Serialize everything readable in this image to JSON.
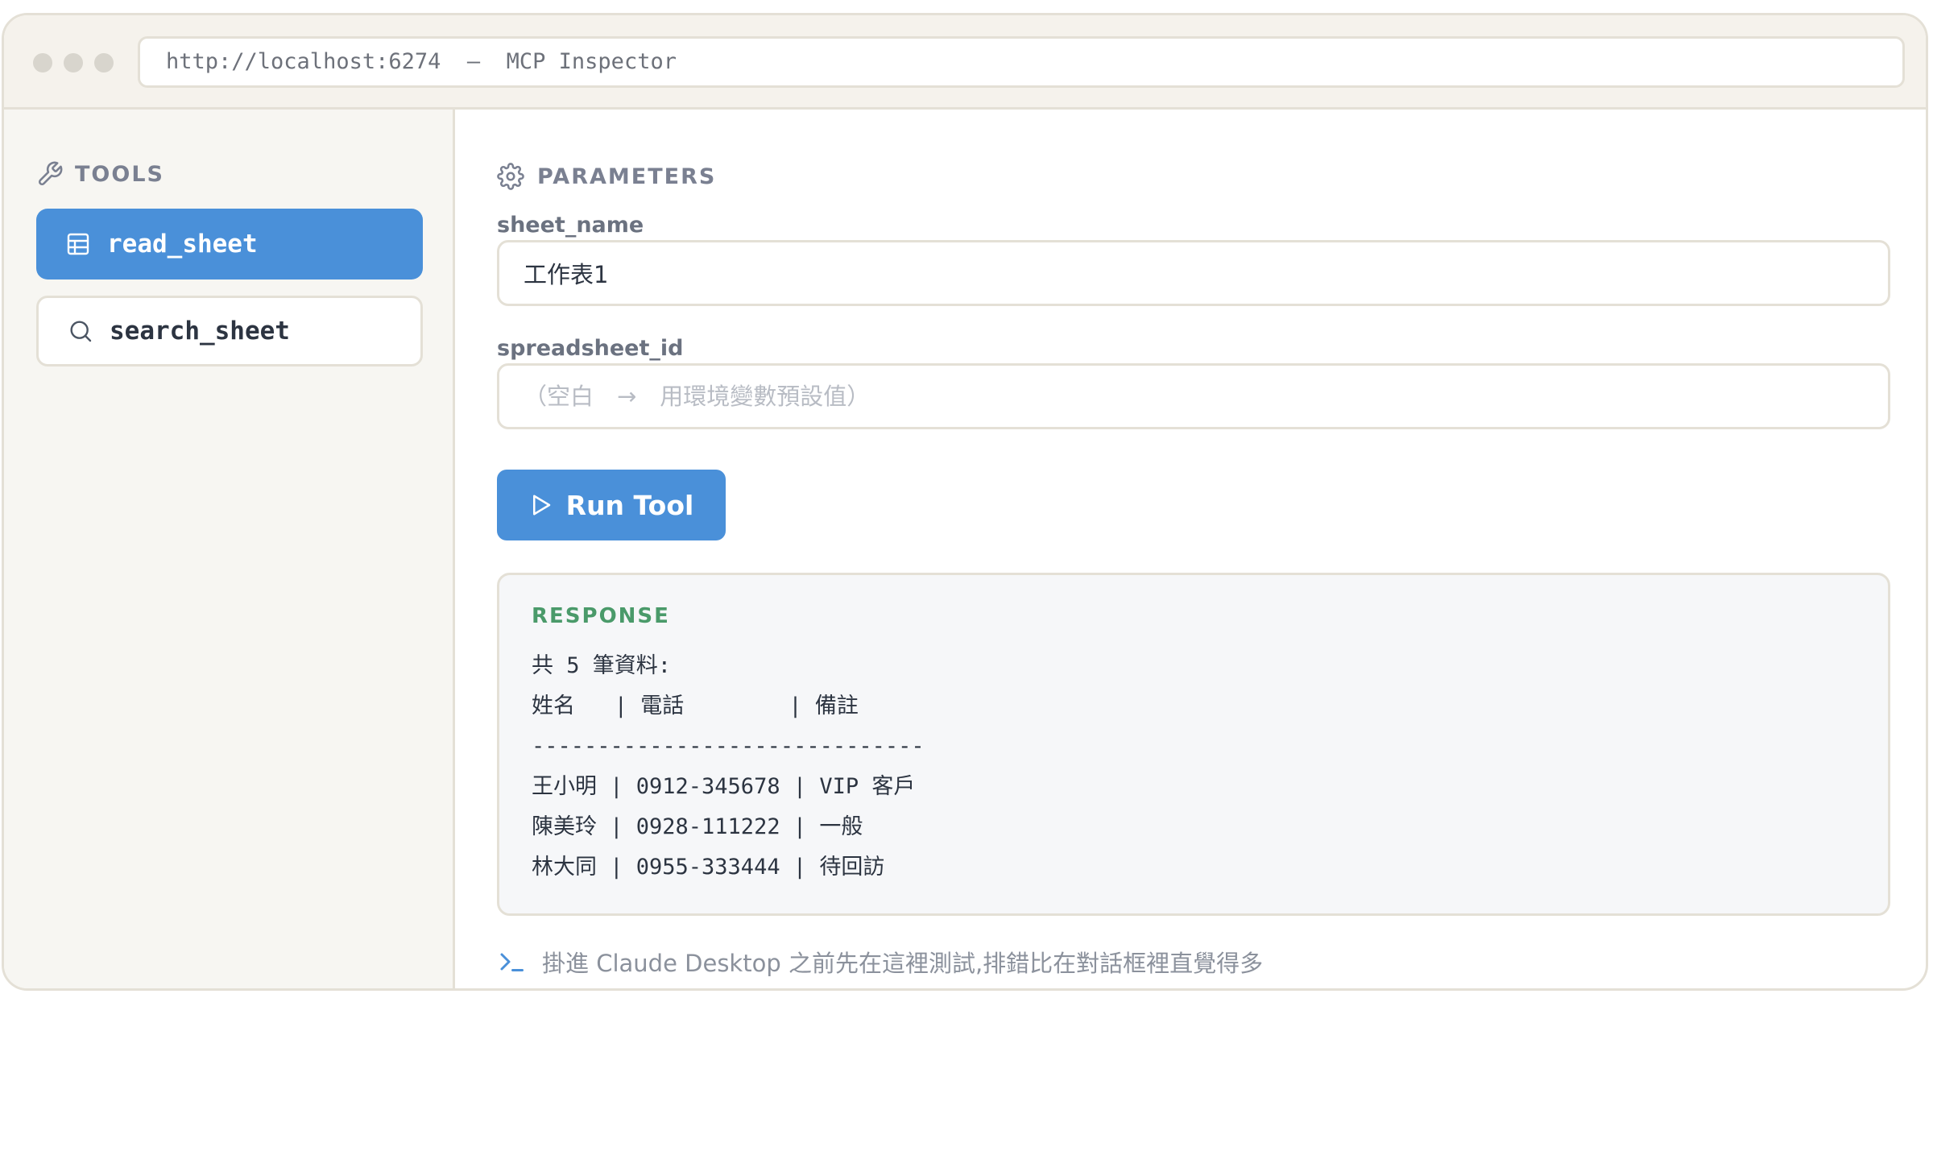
{
  "window": {
    "url": "http://localhost:6274  —  MCP Inspector"
  },
  "sidebar": {
    "heading": "TOOLS",
    "tools": [
      {
        "label": "read_sheet",
        "icon": "table-icon",
        "active": true
      },
      {
        "label": "search_sheet",
        "icon": "search-icon",
        "active": false
      }
    ]
  },
  "params": {
    "heading": "PARAMETERS",
    "fields": [
      {
        "label": "sheet_name",
        "value": "工作表1",
        "placeholder": ""
      },
      {
        "label": "spreadsheet_id",
        "value": "",
        "placeholder": "（空白　→　用環境變數預設值）"
      }
    ]
  },
  "run_button": {
    "label": "Run Tool"
  },
  "response": {
    "heading": "RESPONSE",
    "lines": [
      "共 5 筆資料:",
      "姓名   | 電話        | 備註",
      "------------------------------",
      "王小明 | 0912-345678 | VIP 客戶",
      "陳美玲 | 0928-111222 | 一般",
      "林大同 | 0955-333444 | 待回訪"
    ]
  },
  "footer": {
    "note": "掛進 Claude Desktop 之前先在這裡測試,排錯比在對話框裡直覺得多"
  },
  "colors": {
    "accent": "#4a90d9",
    "response_label": "#4a9a6a",
    "border": "#e4e0d6",
    "muted": "#7a8091"
  }
}
